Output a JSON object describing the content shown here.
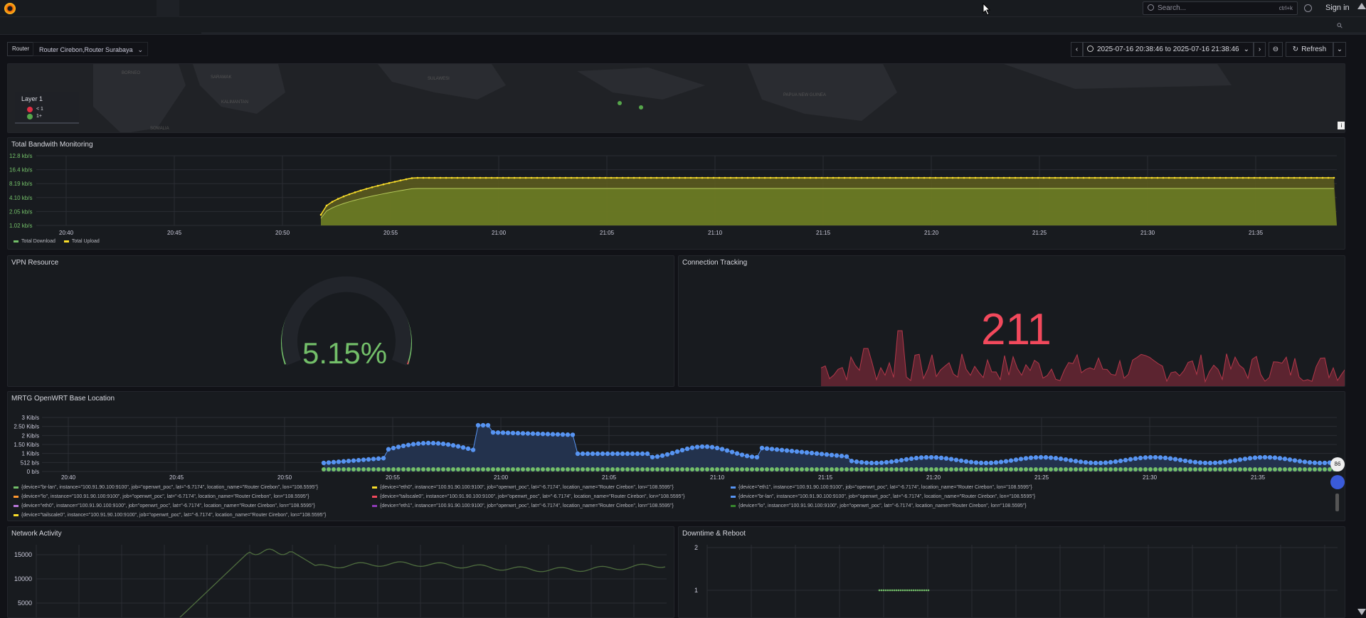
{
  "topbar": {
    "search_placeholder": "Search...",
    "search_shortcut": "ctrl+k",
    "sign_in": "Sign in"
  },
  "variables": {
    "router_label": "Router",
    "router_value": "Router Cirebon,Router Surabaya"
  },
  "time": {
    "range": "2025-07-16 20:38:46 to 2025-07-16 21:38:46",
    "refresh": "Refresh"
  },
  "map": {
    "legend_title": "Layer 1",
    "legend_items": [
      {
        "label": "< 1",
        "color": "#e02f44"
      },
      {
        "label": "1+",
        "color": "#56a64b"
      }
    ],
    "place_labels": [
      "BORNEO",
      "SARAWAK",
      "KALIMANTAN",
      "SULAWESI",
      "PAPUA NEW GUINEA",
      "SOMALIA"
    ]
  },
  "bandwidth": {
    "title": "Total Bandwith Monitoring",
    "y_ticks": [
      "12.8 kb/s",
      "16.4 kb/s",
      "8.19 kb/s",
      "4.10 kb/s",
      "2.05 kb/s",
      "1.02 kb/s"
    ],
    "x_ticks": [
      "20:40",
      "20:45",
      "20:50",
      "20:55",
      "21:00",
      "21:05",
      "21:10",
      "21:15",
      "21:20",
      "21:25",
      "21:30",
      "21:35"
    ],
    "legend": [
      {
        "label": "Total Download",
        "color": "#73bf69"
      },
      {
        "label": "Total Upload",
        "color": "#fade2a"
      }
    ]
  },
  "vpn": {
    "title": "VPN Resource",
    "value": "5.15%",
    "percent": 5.15
  },
  "conntrack": {
    "title": "Connection Tracking",
    "value": "211"
  },
  "mrtg": {
    "title": "MRTG OpenWRT Base Location",
    "y_ticks": [
      "3 Kib/s",
      "2.50 Kib/s",
      "2 Kib/s",
      "1.50 Kib/s",
      "1 Kib/s",
      "512 b/s",
      "0 b/s"
    ],
    "x_ticks": [
      "20:40",
      "20:45",
      "20:50",
      "20:55",
      "21:00",
      "21:05",
      "21:10",
      "21:15",
      "21:20",
      "21:25",
      "21:30",
      "21:35"
    ],
    "legend": [
      {
        "label": "{device=\"br-lan\", instance=\"100.91.90.100:9100\", job=\"openwrt_poc\", lat=\"-6.7174\", location_name=\"Router Cirebon\", lon=\"108.5595\"}",
        "color": "#73bf69"
      },
      {
        "label": "{device=\"eth0\", instance=\"100.91.90.100:9100\", job=\"openwrt_poc\", lat=\"-6.7174\", location_name=\"Router Cirebon\", lon=\"108.5595\"}",
        "color": "#fade2a"
      },
      {
        "label": "{device=\"eth1\", instance=\"100.91.90.100:9100\", job=\"openwrt_poc\", lat=\"-6.7174\", location_name=\"Router Cirebon\", lon=\"108.5595\"}",
        "color": "#5794f2"
      },
      {
        "label": "{device=\"lo\", instance=\"100.91.90.100:9100\", job=\"openwrt_poc\", lat=\"-6.7174\", location_name=\"Router Cirebon\", lon=\"108.5595\"}",
        "color": "#ff9830"
      },
      {
        "label": "{device=\"tailscale0\", instance=\"100.91.90.100:9100\", job=\"openwrt_poc\", lat=\"-6.7174\", location_name=\"Router Cirebon\", lon=\"108.5595\"}",
        "color": "#f2495c"
      },
      {
        "label": "{device=\"br-lan\", instance=\"100.91.90.100:9100\", job=\"openwrt_poc\", lat=\"-6.7174\", location_name=\"Router Cirebon\", lon=\"108.5595\"}",
        "color": "#5794f2"
      },
      {
        "label": "{device=\"eth0\", instance=\"100.91.90.100:9100\", job=\"openwrt_poc\", lat=\"-6.7174\", location_name=\"Router Cirebon\", lon=\"108.5595\"}",
        "color": "#b877d9"
      },
      {
        "label": "{device=\"eth1\", instance=\"100.91.90.100:9100\", job=\"openwrt_poc\", lat=\"-6.7174\", location_name=\"Router Cirebon\", lon=\"108.5595\"}",
        "color": "#8f3bb8"
      },
      {
        "label": "{device=\"lo\", instance=\"100.91.90.100:9100\", job=\"openwrt_poc\", lat=\"-6.7174\", location_name=\"Router Cirebon\", lon=\"108.5595\"}",
        "color": "#37872d"
      },
      {
        "label": "{device=\"tailscale0\", instance=\"100.91.90.100:9100\", job=\"openwrt_poc\", lat=\"-6.7174\", location_name=\"Router Cirebon\", lon=\"108.5595\"}",
        "color": "#fade2a"
      }
    ]
  },
  "network": {
    "title": "Network Activity",
    "y_ticks": [
      "15000",
      "10000",
      "5000"
    ]
  },
  "downtime": {
    "title": "Downtime & Reboot",
    "y_ticks": [
      "2",
      "1"
    ]
  }
}
